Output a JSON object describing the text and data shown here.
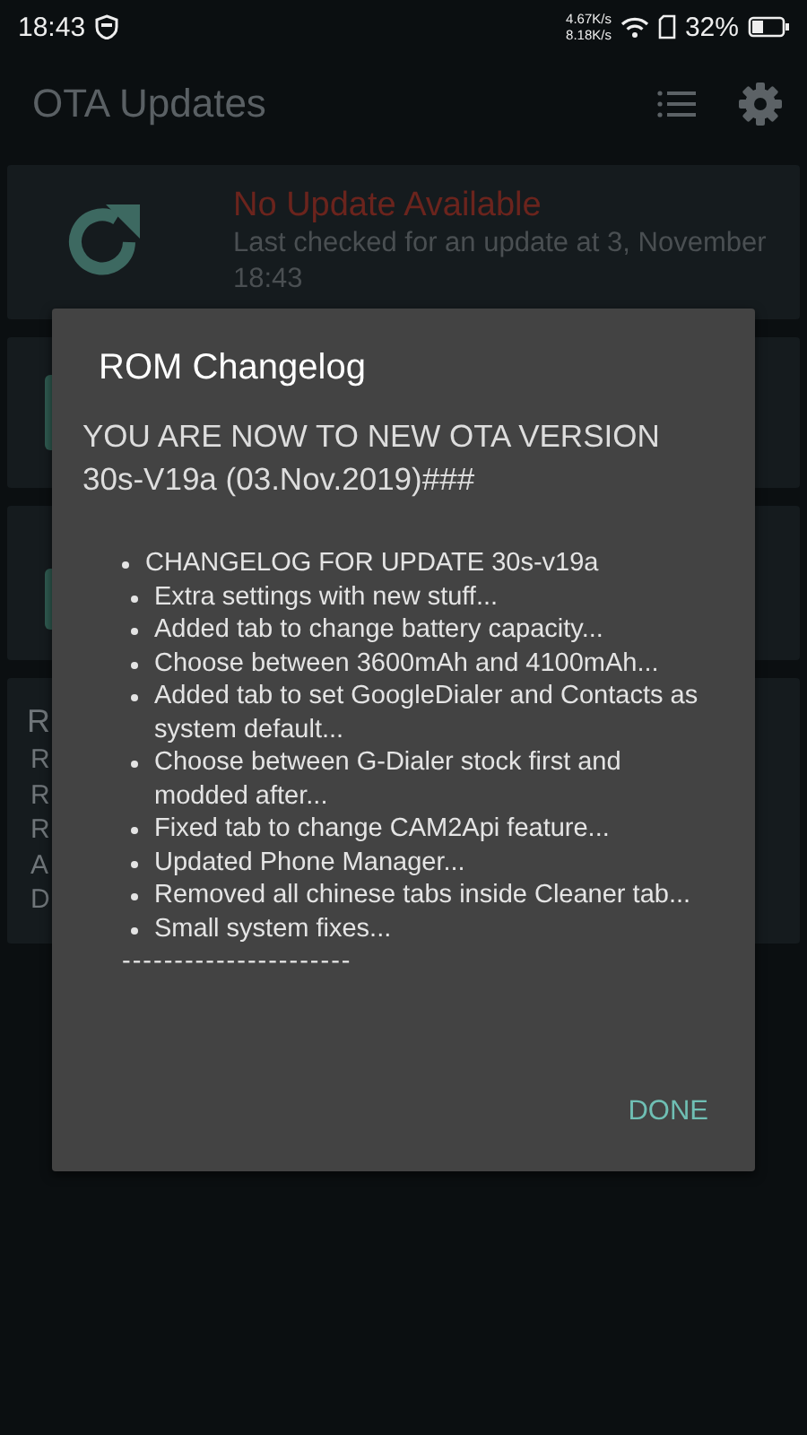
{
  "status_bar": {
    "time": "18:43",
    "upload_speed": "4.67K/s",
    "download_speed": "8.18K/s",
    "battery": "32%"
  },
  "app_bar": {
    "title": "OTA Updates"
  },
  "update_card": {
    "title": "No Update Available",
    "subtitle": "Last checked for an update at 3, November 18:43"
  },
  "info_card": {
    "title": "R",
    "lines": [
      "R",
      "R",
      "R",
      "A",
      "D"
    ]
  },
  "dialog": {
    "title": "ROM Changelog",
    "heading": "YOU ARE NOW TO NEW OTA VERSION 30s-V19a (03.Nov.2019)###",
    "changelog": [
      {
        "text": "CHANGELOG FOR UPDATE 30s-v19a",
        "children": [
          {
            "text": "Extra settings with new stuff..."
          },
          {
            "text": "Added tab to change battery capacity..."
          },
          {
            "text": "Choose between 3600mAh and 4100mAh..."
          },
          {
            "text": "Added tab to set GoogleDialer and Contacts as system default..."
          },
          {
            "text": "Choose between G-Dialer stock first and modded after..."
          },
          {
            "text": "Fixed tab to change CAM2Api feature..."
          },
          {
            "text": "Updated Phone Manager..."
          },
          {
            "text": "Removed all chinese tabs inside Cleaner tab..."
          },
          {
            "text": "Small system fixes..."
          }
        ]
      }
    ],
    "separator": "----------------------",
    "button": "DONE"
  }
}
